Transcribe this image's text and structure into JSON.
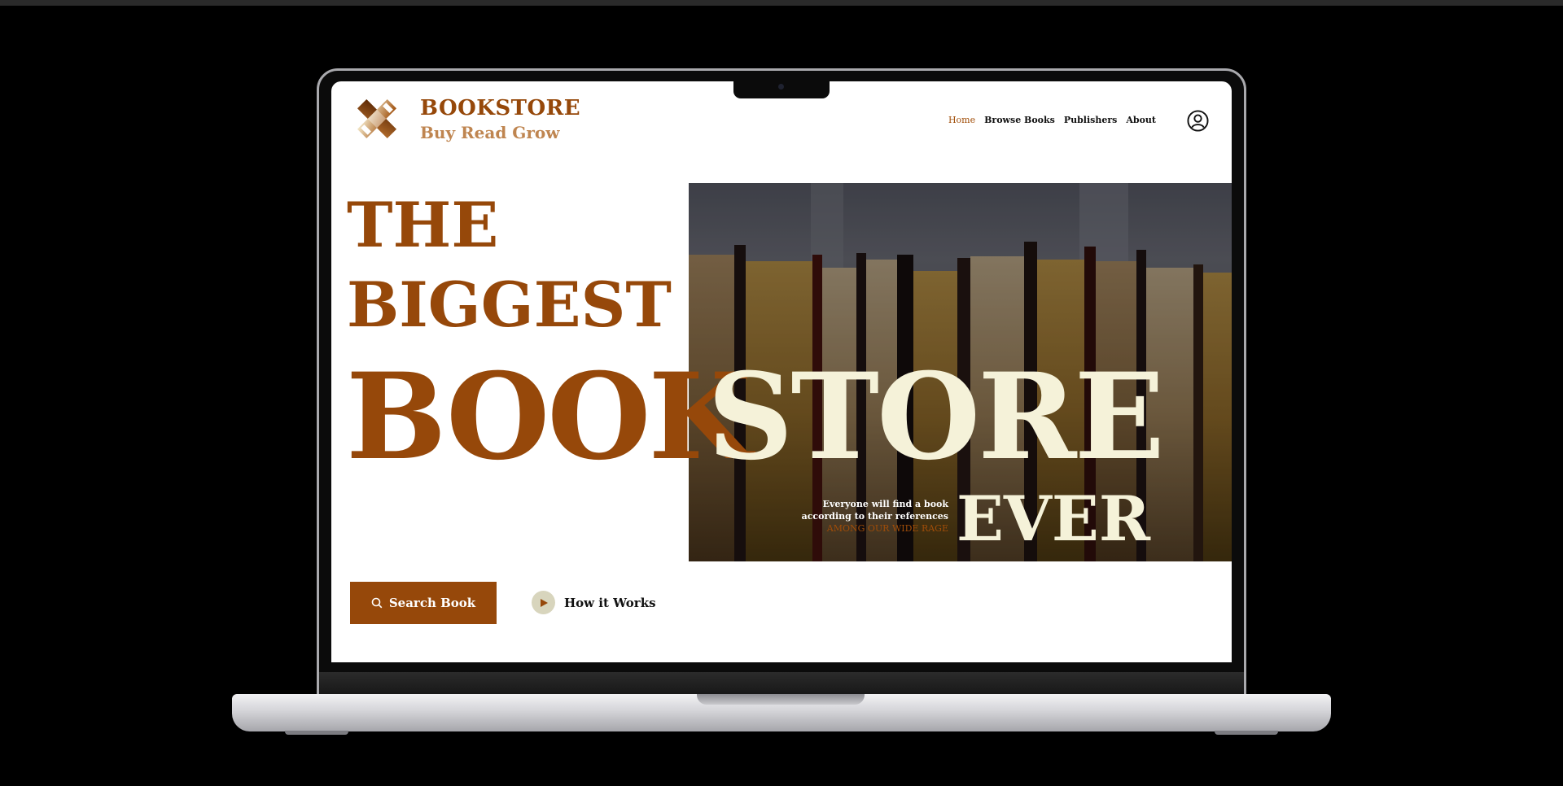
{
  "brand": {
    "name": "BOOKSTORE",
    "tagline": "Buy Read Grow",
    "logo_icon": "x-knot-logo-icon"
  },
  "nav": {
    "items": [
      {
        "label": "Home",
        "active": true
      },
      {
        "label": "Browse Books",
        "active": false
      },
      {
        "label": "Publishers",
        "active": false
      },
      {
        "label": "About",
        "active": false
      }
    ],
    "account_icon": "user-circle-icon"
  },
  "hero": {
    "line1": "THE",
    "line2": "BIGGEST",
    "line3_part1": "BOOK",
    "line3_part2": "STORE",
    "line4": "EVER",
    "subtext": {
      "line1": "Everyone will find a book",
      "line2": "according to their references",
      "line3": "AMONG OUR WIDE RAGE"
    }
  },
  "actions": {
    "search_label": "Search Book",
    "search_icon": "search-icon",
    "how_label": "How it Works",
    "how_icon": "play-icon"
  },
  "colors": {
    "brand_brown": "#96480a",
    "tagline_tan": "#bf8550",
    "cream": "#f5f2d9",
    "play_bg": "#d8d5bd"
  }
}
